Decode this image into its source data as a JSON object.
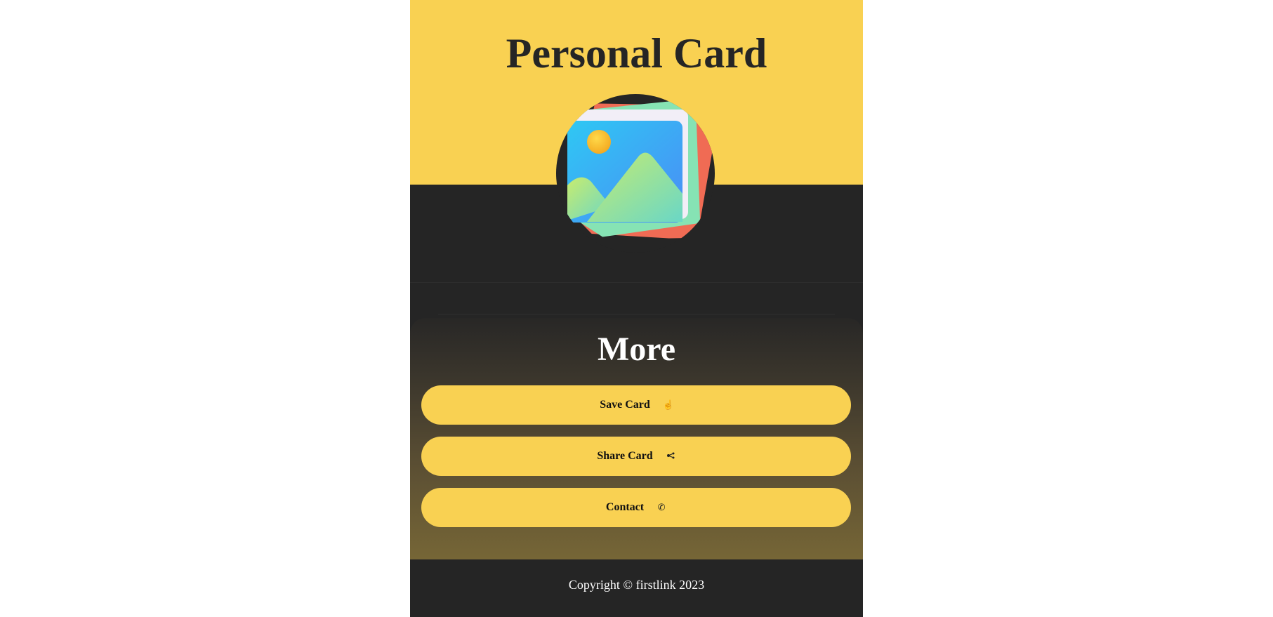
{
  "header": {
    "title": "Personal Card"
  },
  "avatar": {
    "icon": "image-placeholder-icon"
  },
  "more": {
    "title": "More",
    "buttons": [
      {
        "label": "Save Card",
        "icon": "save-hand-icon"
      },
      {
        "label": "Share Card",
        "icon": "share-icon"
      },
      {
        "label": "Contact",
        "icon": "phone-icon"
      }
    ]
  },
  "footer": {
    "copyright": "Copyright © firstlink 2023"
  },
  "colors": {
    "accent": "#f9d152",
    "dark": "#252525",
    "text_light": "#ffffff"
  }
}
